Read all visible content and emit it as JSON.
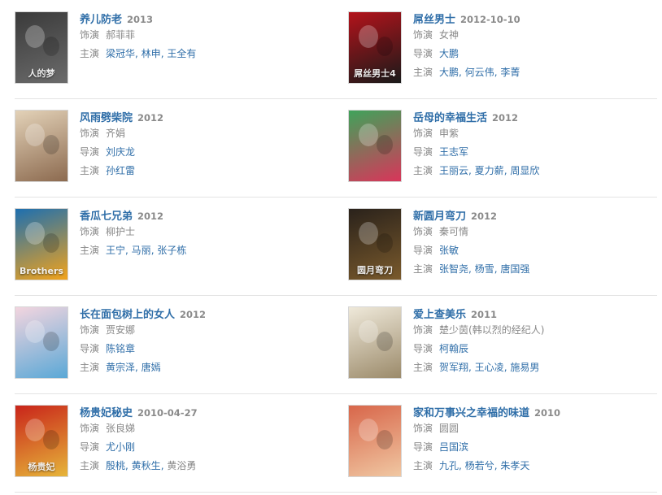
{
  "items": [
    {
      "title": "养儿防老",
      "year": "2013",
      "role_label": "饰演",
      "role": "郝菲菲",
      "director_label": "",
      "director": "",
      "cast_label": "主演",
      "cast": [
        "梁冠华",
        "林申",
        "王全有"
      ],
      "cast_plain": [],
      "poster_text": "人的梦",
      "colors": [
        "#3a3a3a",
        "#6b6b6b"
      ]
    },
    {
      "title": "屌丝男士",
      "year": "2012-10-10",
      "role_label": "饰演",
      "role": "女神",
      "director_label": "导演",
      "director": "大鹏",
      "cast_label": "主演",
      "cast": [
        "大鹏",
        "何云伟",
        "李菁"
      ],
      "cast_plain": [],
      "poster_text": "屌丝男士4",
      "colors": [
        "#b3131b",
        "#1a1a1a"
      ]
    },
    {
      "title": "风雨劈柴院",
      "year": "2012",
      "role_label": "饰演",
      "role": "齐娟",
      "director_label": "导演",
      "director": "刘庆龙",
      "cast_label": "主演",
      "cast": [
        "孙红雷"
      ],
      "cast_plain": [],
      "poster_text": "",
      "colors": [
        "#e3d2b8",
        "#8c6a4f"
      ]
    },
    {
      "title": "岳母的幸福生活",
      "year": "2012",
      "role_label": "饰演",
      "role": "申紫",
      "director_label": "导演",
      "director": "王志军",
      "cast_label": "主演",
      "cast": [
        "王丽云",
        "夏力薪",
        "周显欣"
      ],
      "cast_plain": [],
      "poster_text": "",
      "colors": [
        "#3fa35a",
        "#d9355a"
      ]
    },
    {
      "title": "香瓜七兄弟",
      "year": "2012",
      "role_label": "饰演",
      "role": "柳护士",
      "director_label": "",
      "director": "",
      "cast_label": "主演",
      "cast": [
        "王宁",
        "马丽",
        "张子栋"
      ],
      "cast_plain": [],
      "poster_text": "Brothers",
      "colors": [
        "#1d6fb0",
        "#f2a31b"
      ]
    },
    {
      "title": "新圆月弯刀",
      "year": "2012",
      "role_label": "饰演",
      "role": "秦可情",
      "director_label": "导演",
      "director": "张敏",
      "cast_label": "主演",
      "cast": [
        "张智尧",
        "杨雪",
        "唐国强"
      ],
      "cast_plain": [],
      "poster_text": "圆月弯刀",
      "colors": [
        "#2a221b",
        "#7a5a2c"
      ]
    },
    {
      "title": "长在面包树上的女人",
      "year": "2012",
      "role_label": "饰演",
      "role": "贾安娜",
      "director_label": "导演",
      "director": "陈铭章",
      "cast_label": "主演",
      "cast": [
        "黄宗泽",
        "唐嫣"
      ],
      "cast_plain": [],
      "poster_text": "",
      "colors": [
        "#f3d5df",
        "#5aa8d6"
      ]
    },
    {
      "title": "爱上查美乐",
      "year": "2011",
      "role_label": "饰演",
      "role": "楚少茵(韩以烈的经纪人)",
      "director_label": "导演",
      "director": "柯翰辰",
      "cast_label": "主演",
      "cast": [
        "贺军翔",
        "王心凌",
        "施易男"
      ],
      "cast_plain": [],
      "poster_text": "",
      "colors": [
        "#efe9da",
        "#9b8a6a"
      ]
    },
    {
      "title": "杨贵妃秘史",
      "year": "2010-04-27",
      "role_label": "饰演",
      "role": "张良娣",
      "director_label": "导演",
      "director": "尤小刚",
      "cast_label": "主演",
      "cast": [
        "殷桃",
        "黄秋生"
      ],
      "cast_plain": [
        "黄浴勇"
      ],
      "poster_text": "杨贵妃",
      "colors": [
        "#c9241a",
        "#e6b53a"
      ]
    },
    {
      "title": "家和万事兴之幸福的味道",
      "year": "2010",
      "role_label": "饰演",
      "role": "圆圆",
      "director_label": "导演",
      "director": "吕国滨",
      "cast_label": "主演",
      "cast": [
        "九孔",
        "杨若兮",
        "朱孝天"
      ],
      "cast_plain": [],
      "poster_text": "",
      "colors": [
        "#d8664a",
        "#f0c7a2"
      ]
    }
  ]
}
